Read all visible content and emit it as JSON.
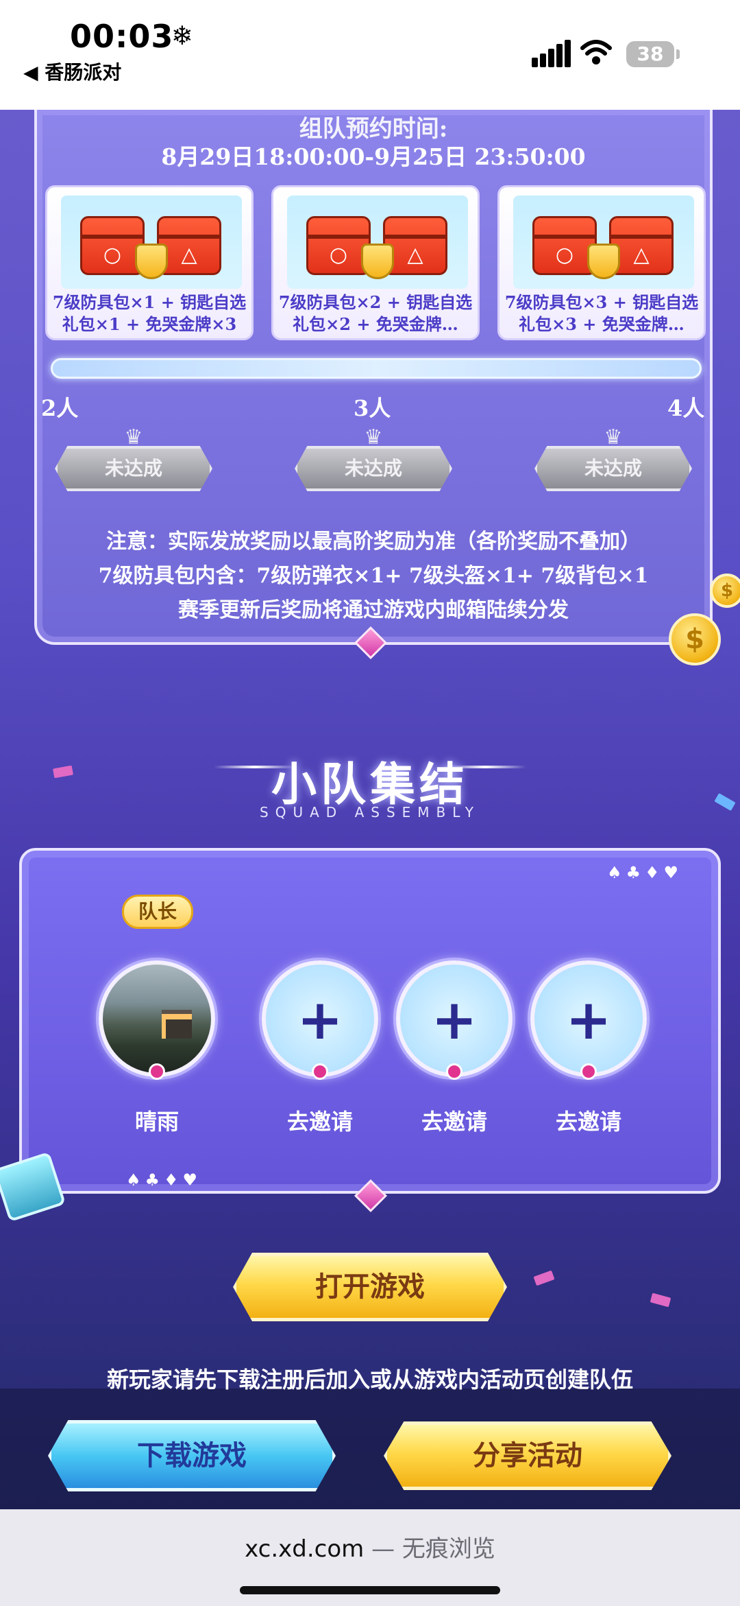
{
  "status_bar": {
    "time": "00:03",
    "weather_icon": "snowflake-icon",
    "back_app": "香肠派对",
    "battery": "38"
  },
  "reward_panel": {
    "heading": "组队预约时间:",
    "time_range": "8月29日18:00:00-9月25日 23:50:00",
    "rewards": [
      {
        "caption": "7级防具包×1 + 钥匙自选礼包×1 + 免哭金牌×3"
      },
      {
        "caption": "7级防具包×2 + 钥匙自选礼包×2 + 免哭金牌…"
      },
      {
        "caption": "7级防具包×3 + 钥匙自选礼包×3 + 免哭金牌…"
      }
    ],
    "tiers": [
      {
        "people": "2人",
        "status": "未达成"
      },
      {
        "people": "3人",
        "status": "未达成"
      },
      {
        "people": "4人",
        "status": "未达成"
      }
    ],
    "notes": [
      "注意：实际发放奖励以最高阶奖励为准（各阶奖励不叠加）",
      "7级防具包内含：7级防弹衣×1+ 7级头盔×1+ 7级背包×1",
      "赛季更新后奖励将通过游戏内邮箱陆续分发"
    ]
  },
  "squad": {
    "title": "小队集结",
    "subtitle": "SQUAD ASSEMBLY",
    "leader_label": "队长",
    "suits": "♠♣♦♥",
    "members": [
      {
        "name": "晴雨",
        "type": "avatar"
      },
      {
        "name": "去邀请",
        "type": "invite"
      },
      {
        "name": "去邀请",
        "type": "invite"
      },
      {
        "name": "去邀请",
        "type": "invite"
      }
    ]
  },
  "actions": {
    "open_game": "打开游戏",
    "hint": "新玩家请先下载注册后加入或从游戏内活动页创建队伍",
    "download_game": "下载游戏",
    "share_activity": "分享活动"
  },
  "browser": {
    "host": "xc.xd.com",
    "separator": " — ",
    "mode": "无痕浏览"
  },
  "colors": {
    "panel_purple": "#7d73e0",
    "card_text": "#4b3cc7",
    "gold": "#ffd94a",
    "blue": "#48c7f3"
  }
}
